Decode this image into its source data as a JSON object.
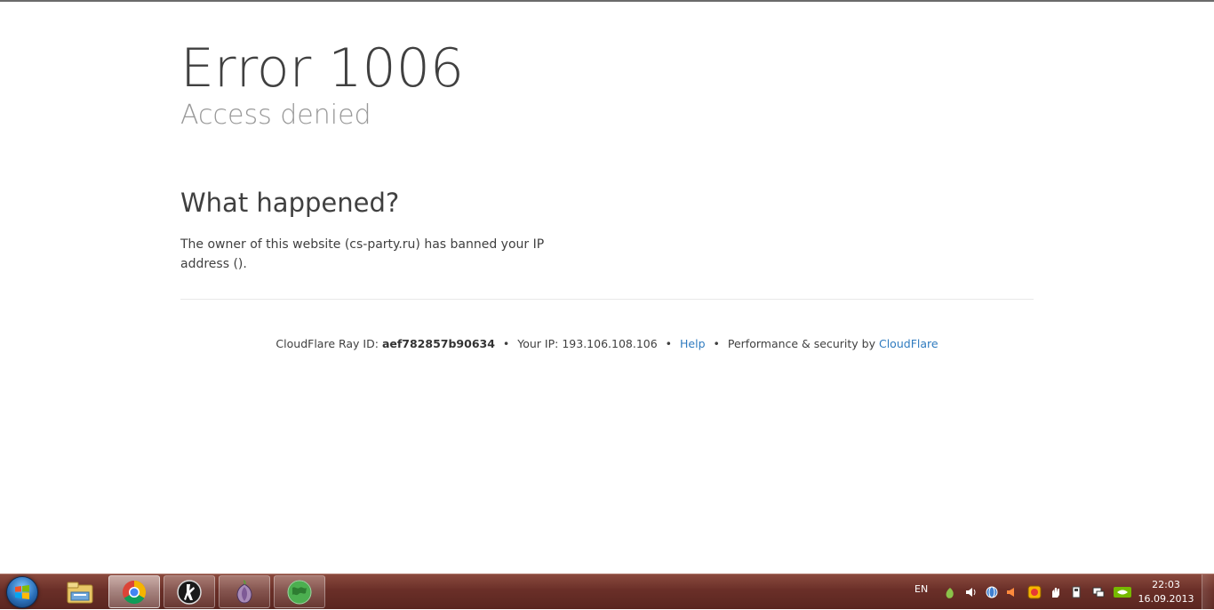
{
  "error": {
    "title": "Error 1006",
    "subtitle": "Access denied"
  },
  "what_happened": {
    "heading": "What happened?",
    "body": "The owner of this website (cs-party.ru) has banned your IP address ()."
  },
  "footer": {
    "ray_label": "CloudFlare Ray ID:",
    "ray_id": "aef782857b90634",
    "ip_label": "Your IP: 193.106.108.106",
    "help_link": "Help",
    "perf_label": "Performance & security by",
    "cloudflare_link": "CloudFlare",
    "separator": "•"
  },
  "taskbar": {
    "start": "start-orb-icon",
    "apps": [
      {
        "name": "file-explorer-icon",
        "state": "pinned"
      },
      {
        "name": "chrome-icon",
        "state": "active"
      },
      {
        "name": "counter-strike-icon",
        "state": "open"
      },
      {
        "name": "tor-onion-icon",
        "state": "open"
      },
      {
        "name": "globe-app-icon",
        "state": "open"
      }
    ],
    "language": "EN",
    "clock_time": "22:03",
    "clock_date": "16.09.2013"
  },
  "colors": {
    "link": "#2f7bbf",
    "title_text": "#404040",
    "subtitle_text": "#999999",
    "taskbar": "#6a2f28"
  }
}
